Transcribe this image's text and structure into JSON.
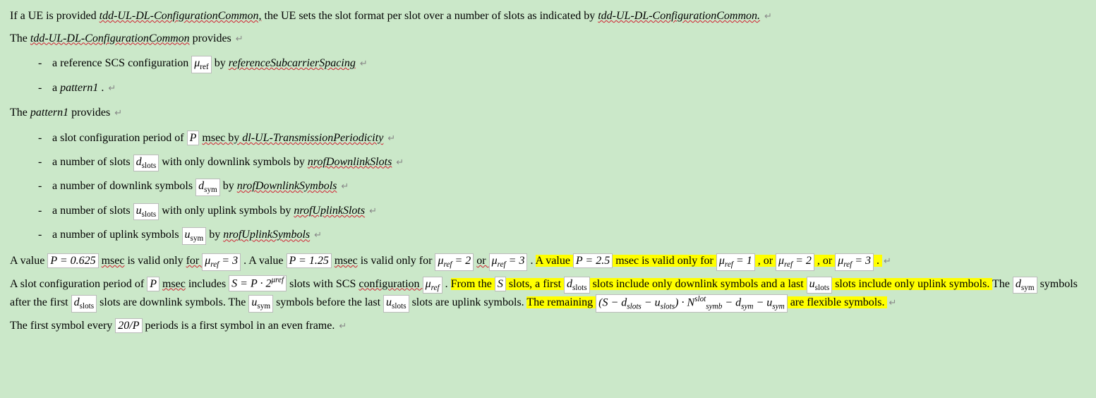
{
  "ret": "↵",
  "p1a": "If a UE is provided ",
  "p1b": "tdd-UL-DL-ConfigurationCommon,",
  "p1c": " the UE sets the slot format per slot over a number of slots as indicated by ",
  "p1d": "tdd-UL-DL-ConfigurationCommon.",
  "p2a": "The ",
  "p2b": "tdd-UL-DL-ConfigurationCommon",
  "p2c": " provides",
  "l1a_a": "a reference SCS configuration ",
  "mu_ref": "μ",
  "mu_ref_sub": "ref",
  "l1a_b": " by ",
  "l1a_c": "referenceSubcarrierSpacing",
  "l1b_a": "a ",
  "l1b_b": "pattern1",
  "l1b_c": ".",
  "p3a": "The ",
  "p3b": "pattern1",
  "p3c": " provides",
  "l2a_a": "a slot configuration period of ",
  "P": "P",
  "l2a_b": " msec by ",
  "l2a_c": "dl-UL-TransmissionPeriodicity",
  "l2b_a": "a number of slots ",
  "d": "d",
  "slots_sub": "slots",
  "l2b_b": " with only downlink symbols by ",
  "l2b_c": "nrofDownlinkSlots",
  "l2c_a": "a number of downlink symbols ",
  "sym_sub": "sym",
  "l2c_b": " by ",
  "l2c_c": "nrofDownlinkSymbols",
  "l2d_a": "a number of slots ",
  "u": "u",
  "l2d_b": " with only uplink symbols by ",
  "l2d_c": "nrofUplinkSlots",
  "l2e_a": "a number of uplink symbols ",
  "l2e_b": " by ",
  "l2e_c": "nrofUplinkSymbols",
  "p4a": "A value ",
  "p4b": "P = 0.625",
  "p4c": " msec",
  "p4d": " is valid only ",
  "p4e": "for ",
  "p4f": " = 3",
  "p4g": ".  A value ",
  "p4h": "P = 1.25",
  "p4i": " msec",
  "p4j": " is valid only for ",
  "p4k": " = 2",
  "p4l": " or ",
  "p4m": " = 3",
  "p4n": ". ",
  "p4o": "A value ",
  "p4p": "P = 2.5",
  "p4q": " msec",
  "p4r": " is valid only for ",
  "p4s": " = 1",
  "p4t": ", or ",
  "p4u": " = 2",
  "p4v": ", or ",
  "p4w": " = 3",
  "p4x": ".",
  "p5a": "A slot configuration period of ",
  "p5b": " msec",
  "p5c": " includes ",
  "S_eq": "S = P · 2",
  "S_eq_sup": "μref",
  "p5d": " slots with SCS ",
  "p5e": "configuration ",
  "p5f": " . ",
  "p5g": "From the",
  "S": "S",
  "p5h": " slots, a first ",
  "p5i": " slots include only downlink symbols and a last ",
  "p5j": " slots include only uplink symbols. ",
  "p5k": "The ",
  "p5l": " symbols after the first ",
  "p5m": " slots are downlink symbols. The ",
  "p5n": " symbols before the last ",
  "p5o": " slots are uplink symbols. ",
  "p5p": "The remaining ",
  "expr1a": "(S − d",
  "expr1b": " − u",
  "expr1c": ") · N",
  "expr1_slot": "slot",
  "expr1_symb": "symb",
  "expr1d": " − d",
  "expr1e": " − u",
  "p5q": " are flexible symbols.",
  "p6a": "The first symbol every ",
  "p6b": "20/P",
  "p6c": " periods is a first symbol in an even frame."
}
